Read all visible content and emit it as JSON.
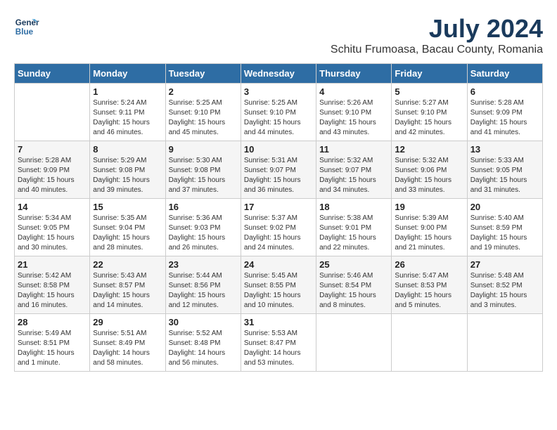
{
  "logo": {
    "line1": "General",
    "line2": "Blue"
  },
  "title": "July 2024",
  "subtitle": "Schitu Frumoasa, Bacau County, Romania",
  "days_header": [
    "Sunday",
    "Monday",
    "Tuesday",
    "Wednesday",
    "Thursday",
    "Friday",
    "Saturday"
  ],
  "weeks": [
    [
      {
        "day": "",
        "info": ""
      },
      {
        "day": "1",
        "info": "Sunrise: 5:24 AM\nSunset: 9:11 PM\nDaylight: 15 hours\nand 46 minutes."
      },
      {
        "day": "2",
        "info": "Sunrise: 5:25 AM\nSunset: 9:10 PM\nDaylight: 15 hours\nand 45 minutes."
      },
      {
        "day": "3",
        "info": "Sunrise: 5:25 AM\nSunset: 9:10 PM\nDaylight: 15 hours\nand 44 minutes."
      },
      {
        "day": "4",
        "info": "Sunrise: 5:26 AM\nSunset: 9:10 PM\nDaylight: 15 hours\nand 43 minutes."
      },
      {
        "day": "5",
        "info": "Sunrise: 5:27 AM\nSunset: 9:10 PM\nDaylight: 15 hours\nand 42 minutes."
      },
      {
        "day": "6",
        "info": "Sunrise: 5:28 AM\nSunset: 9:09 PM\nDaylight: 15 hours\nand 41 minutes."
      }
    ],
    [
      {
        "day": "7",
        "info": "Sunrise: 5:28 AM\nSunset: 9:09 PM\nDaylight: 15 hours\nand 40 minutes."
      },
      {
        "day": "8",
        "info": "Sunrise: 5:29 AM\nSunset: 9:08 PM\nDaylight: 15 hours\nand 39 minutes."
      },
      {
        "day": "9",
        "info": "Sunrise: 5:30 AM\nSunset: 9:08 PM\nDaylight: 15 hours\nand 37 minutes."
      },
      {
        "day": "10",
        "info": "Sunrise: 5:31 AM\nSunset: 9:07 PM\nDaylight: 15 hours\nand 36 minutes."
      },
      {
        "day": "11",
        "info": "Sunrise: 5:32 AM\nSunset: 9:07 PM\nDaylight: 15 hours\nand 34 minutes."
      },
      {
        "day": "12",
        "info": "Sunrise: 5:32 AM\nSunset: 9:06 PM\nDaylight: 15 hours\nand 33 minutes."
      },
      {
        "day": "13",
        "info": "Sunrise: 5:33 AM\nSunset: 9:05 PM\nDaylight: 15 hours\nand 31 minutes."
      }
    ],
    [
      {
        "day": "14",
        "info": "Sunrise: 5:34 AM\nSunset: 9:05 PM\nDaylight: 15 hours\nand 30 minutes."
      },
      {
        "day": "15",
        "info": "Sunrise: 5:35 AM\nSunset: 9:04 PM\nDaylight: 15 hours\nand 28 minutes."
      },
      {
        "day": "16",
        "info": "Sunrise: 5:36 AM\nSunset: 9:03 PM\nDaylight: 15 hours\nand 26 minutes."
      },
      {
        "day": "17",
        "info": "Sunrise: 5:37 AM\nSunset: 9:02 PM\nDaylight: 15 hours\nand 24 minutes."
      },
      {
        "day": "18",
        "info": "Sunrise: 5:38 AM\nSunset: 9:01 PM\nDaylight: 15 hours\nand 22 minutes."
      },
      {
        "day": "19",
        "info": "Sunrise: 5:39 AM\nSunset: 9:00 PM\nDaylight: 15 hours\nand 21 minutes."
      },
      {
        "day": "20",
        "info": "Sunrise: 5:40 AM\nSunset: 8:59 PM\nDaylight: 15 hours\nand 19 minutes."
      }
    ],
    [
      {
        "day": "21",
        "info": "Sunrise: 5:42 AM\nSunset: 8:58 PM\nDaylight: 15 hours\nand 16 minutes."
      },
      {
        "day": "22",
        "info": "Sunrise: 5:43 AM\nSunset: 8:57 PM\nDaylight: 15 hours\nand 14 minutes."
      },
      {
        "day": "23",
        "info": "Sunrise: 5:44 AM\nSunset: 8:56 PM\nDaylight: 15 hours\nand 12 minutes."
      },
      {
        "day": "24",
        "info": "Sunrise: 5:45 AM\nSunset: 8:55 PM\nDaylight: 15 hours\nand 10 minutes."
      },
      {
        "day": "25",
        "info": "Sunrise: 5:46 AM\nSunset: 8:54 PM\nDaylight: 15 hours\nand 8 minutes."
      },
      {
        "day": "26",
        "info": "Sunrise: 5:47 AM\nSunset: 8:53 PM\nDaylight: 15 hours\nand 5 minutes."
      },
      {
        "day": "27",
        "info": "Sunrise: 5:48 AM\nSunset: 8:52 PM\nDaylight: 15 hours\nand 3 minutes."
      }
    ],
    [
      {
        "day": "28",
        "info": "Sunrise: 5:49 AM\nSunset: 8:51 PM\nDaylight: 15 hours\nand 1 minute."
      },
      {
        "day": "29",
        "info": "Sunrise: 5:51 AM\nSunset: 8:49 PM\nDaylight: 14 hours\nand 58 minutes."
      },
      {
        "day": "30",
        "info": "Sunrise: 5:52 AM\nSunset: 8:48 PM\nDaylight: 14 hours\nand 56 minutes."
      },
      {
        "day": "31",
        "info": "Sunrise: 5:53 AM\nSunset: 8:47 PM\nDaylight: 14 hours\nand 53 minutes."
      },
      {
        "day": "",
        "info": ""
      },
      {
        "day": "",
        "info": ""
      },
      {
        "day": "",
        "info": ""
      }
    ]
  ]
}
